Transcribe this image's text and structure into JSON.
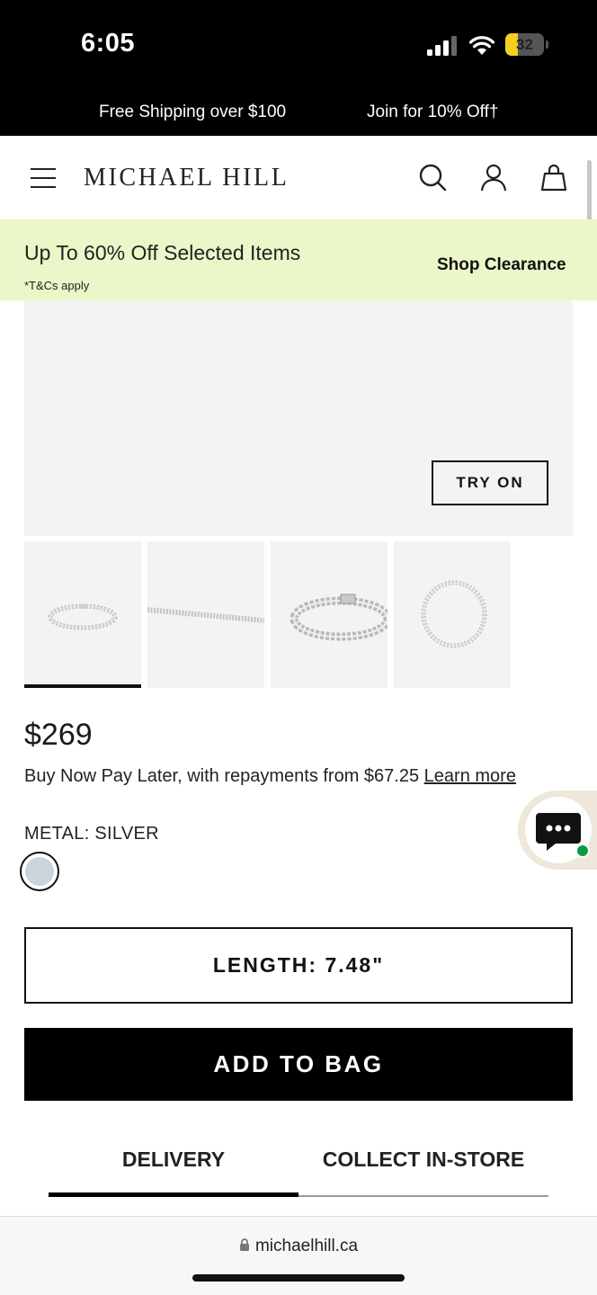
{
  "status_bar": {
    "time": "6:05",
    "battery": "32",
    "battery_level_percent": 32
  },
  "promo": {
    "left": "Free Shipping over $100",
    "right": "Join for 10% Off†"
  },
  "header": {
    "logo": "MICHAEL HILL"
  },
  "clearance": {
    "title": "Up To 60% Off Selected Items",
    "terms": "*T&Cs apply",
    "link": "Shop Clearance"
  },
  "hero": {
    "try_on": "TRY ON"
  },
  "product": {
    "price": "$269",
    "bnpl_text": "Buy Now Pay Later, with repayments from $67.25",
    "learn_more": "Learn more",
    "metal_label": "METAL: SILVER",
    "metal_color": "#cdd3da",
    "length_button": "LENGTH: 7.48\"",
    "add_to_bag": "ADD TO BAG"
  },
  "tabs": [
    {
      "label": "DELIVERY",
      "active": true
    },
    {
      "label": "COLLECT IN-STORE",
      "active": false
    }
  ],
  "browser": {
    "url": "michaelhill.ca"
  },
  "colors": {
    "clearance_bg": "#ebf7c8",
    "chat_bg": "#eee7da",
    "online_dot": "#0a9a4a"
  }
}
